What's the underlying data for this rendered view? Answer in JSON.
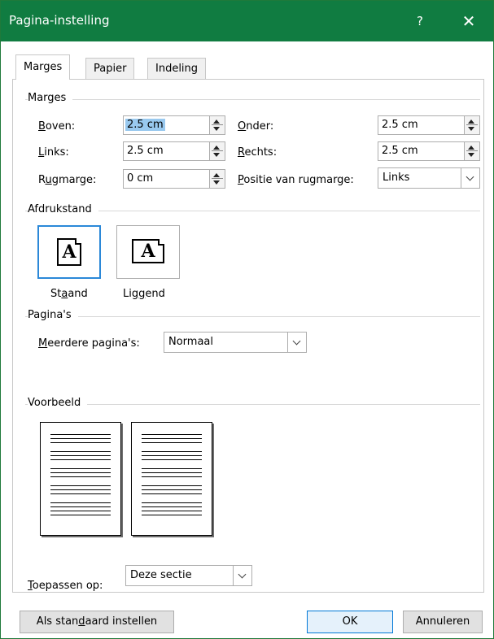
{
  "window": {
    "title": "Pagina-instelling",
    "help_label": "?",
    "close_label": "✕"
  },
  "tabs": [
    {
      "label": "Marges",
      "active": true
    },
    {
      "label": "Papier",
      "active": false
    },
    {
      "label": "Indeling",
      "active": false
    }
  ],
  "margins": {
    "section_title": "Marges",
    "top": {
      "label": "Boven:",
      "value": "2.5 cm"
    },
    "bottom": {
      "label": "Onder:",
      "value": "2.5 cm"
    },
    "left": {
      "label": "Links:",
      "value": "2.5 cm"
    },
    "right": {
      "label": "Rechts:",
      "value": "2.5 cm"
    },
    "gutter": {
      "label": "Rugmarge:",
      "value": "0 cm"
    },
    "gutter_position": {
      "label": "Positie van rugmarge:",
      "value": "Links"
    }
  },
  "orientation": {
    "section_title": "Afdrukstand",
    "portrait": {
      "label": "Staand",
      "glyph": "A",
      "selected": true
    },
    "landscape": {
      "label": "Liggend",
      "glyph": "A",
      "selected": false
    }
  },
  "pages": {
    "section_title": "Pagina's",
    "multiple_pages": {
      "label": "Meerdere pagina's:",
      "value": "Normaal"
    }
  },
  "preview": {
    "section_title": "Voorbeeld"
  },
  "apply_to": {
    "label": "Toepassen op:",
    "value": "Deze sectie"
  },
  "buttons": {
    "set_default": "Als standaard instellen",
    "ok": "OK",
    "cancel": "Annuleren"
  },
  "colors": {
    "titlebar": "#107c41",
    "selection": "#99c9ef",
    "focus_border": "#2b88d8"
  }
}
